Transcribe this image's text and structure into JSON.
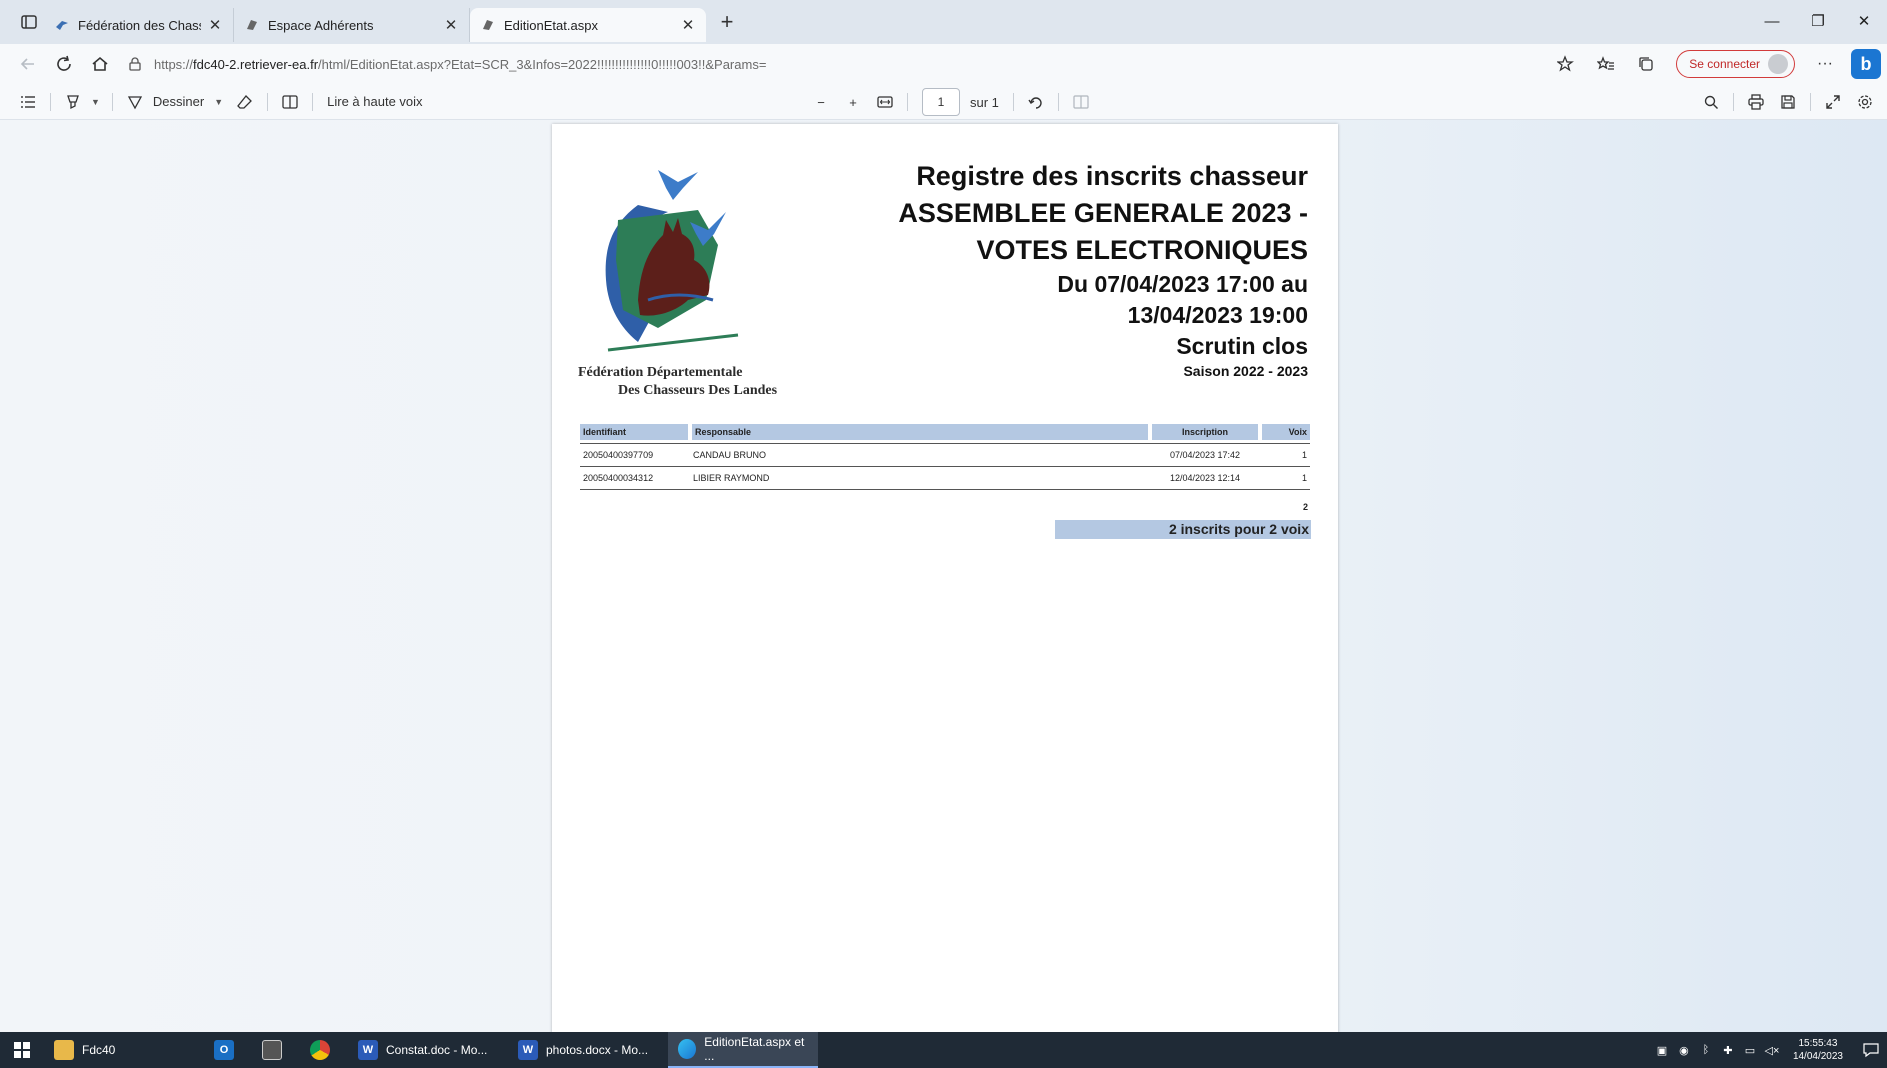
{
  "browser": {
    "tabs": [
      {
        "title": "Fédération des Chasseurs des La",
        "close": "✕",
        "active": false
      },
      {
        "title": "Espace Adhérents",
        "close": "✕",
        "active": false
      },
      {
        "title": "EditionEtat.aspx",
        "close": "✕",
        "active": true
      }
    ],
    "new_tab": "+",
    "window_controls": {
      "minimize": "—",
      "restore": "❐",
      "close": "✕"
    },
    "url": {
      "prefix": "https://",
      "host": "fdc40-2.retriever-ea.fr",
      "path": "/html/EditionEtat.aspx?Etat=SCR_3&Infos=2022!!!!!!!!!!!!!!!0!!!!!003!!&Params="
    },
    "signin_label": "Se connecter",
    "more": "···"
  },
  "pdf_toolbar": {
    "draw_label": "Dessiner",
    "read_aloud_label": "Lire à haute voix",
    "zoom_out": "−",
    "zoom_in": "+",
    "page_current": "1",
    "page_total": "sur 1"
  },
  "document": {
    "logo_line1": "Fédération Départementale",
    "logo_line2": "Des Chasseurs Des Landes",
    "title_line1": "Registre des inscrits chasseur",
    "title_line2": "ASSEMBLEE GENERALE 2023 -",
    "title_line3": "VOTES ELECTRONIQUES",
    "period_line1": "Du 07/04/2023 17:00 au",
    "period_line2": "13/04/2023 19:00",
    "status": "Scrutin clos",
    "season": "Saison 2022 - 2023",
    "table": {
      "headers": {
        "id": "Identifiant",
        "resp": "Responsable",
        "insc": "Inscription",
        "voix": "Voix"
      },
      "rows": [
        {
          "id": "20050400397709",
          "resp": "CANDAU BRUNO",
          "insc": "07/04/2023 17:42",
          "voix": "1"
        },
        {
          "id": "20050400034312",
          "resp": "LIBIER RAYMOND",
          "insc": "12/04/2023 12:14",
          "voix": "1"
        }
      ]
    },
    "total_votes": "2",
    "summary": "2 inscrits pour 2 voix"
  },
  "taskbar": {
    "items": [
      {
        "label": "Fdc40"
      },
      {
        "label": "Constat.doc - Mo..."
      },
      {
        "label": "photos.docx - Mo..."
      },
      {
        "label": "EditionEtat.aspx et ..."
      }
    ],
    "time": "15:55:43",
    "date": "14/04/2023"
  },
  "colors": {
    "header_fill": "#b4c8e2",
    "signin_border": "#d23b3b",
    "taskbar": "#1f2a36"
  }
}
